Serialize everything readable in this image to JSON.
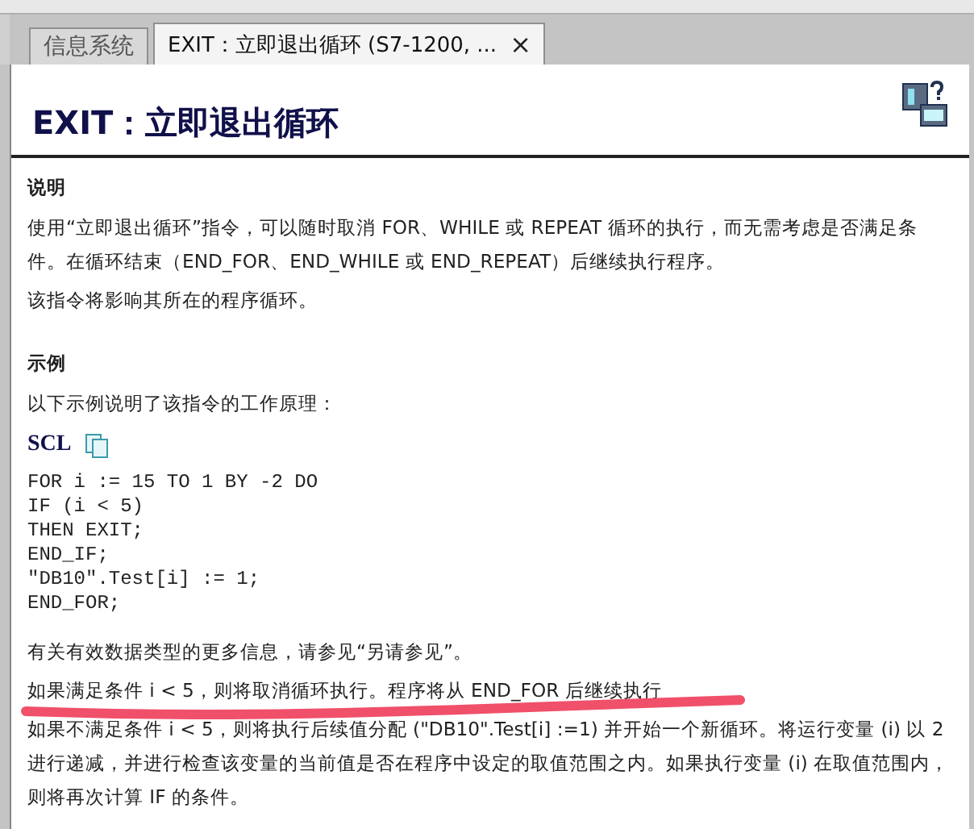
{
  "tabs": [
    {
      "label": "信息系统",
      "selected": false,
      "closable": false
    },
    {
      "label": "EXIT：立即退出循环 (S7-1200, ...",
      "selected": true,
      "closable": true
    }
  ],
  "close_symbol": "×",
  "title": "EXIT：立即退出循环",
  "sections": [
    {
      "heading": "说明",
      "blocks": [
        {
          "kind": "text",
          "text": "使用“立即退出循环”指令，可以随时取消 FOR、WHILE 或 REPEAT 循环的执行，而无需考虑是否满足条件。在循环结束（END_FOR、END_WHILE 或 END_REPEAT）后继续执行程序。",
          "marked": false
        },
        {
          "kind": "text",
          "text": "该指令将影响其所在的程序循环。",
          "marked": false
        }
      ]
    },
    {
      "heading": "示例",
      "blocks": [
        {
          "kind": "text",
          "text": "以下示例说明了该指令的工作原理：",
          "marked": false
        },
        {
          "kind": "code",
          "language": "SCL",
          "lines": [
            "FOR i := 15 TO 1 BY -2 DO",
            "IF (i < 5)",
            "THEN EXIT;",
            "END_IF;",
            "\"DB10\".Test[i] := 1;",
            "END_FOR;"
          ]
        },
        {
          "kind": "text",
          "text": "有关有效数据类型的更多信息，请参见“另请参见”。",
          "marked": false
        },
        {
          "kind": "text",
          "text": "如果满足条件 i < 5，则将取消循环执行。程序将从 END_FOR 后继续执行",
          "marked": true
        },
        {
          "kind": "text",
          "text": "如果不满足条件 i < 5，则将执行后续值分配 (\"DB10\".Test[i] :=1) 并开始一个新循环。将运行变量 (i) 以 2 进行递减，并进行检查该变量的当前值是否在程序中设定的取值范围之内。如果执行变量 (i) 在取值范围内，则将再次计算 IF 的条件。",
          "marked": false
        }
      ]
    }
  ]
}
